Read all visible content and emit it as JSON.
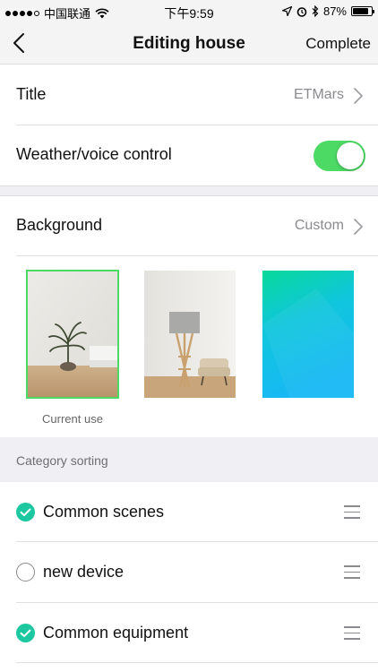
{
  "status_bar": {
    "carrier": "中国联通",
    "time": "下午9:59",
    "battery": "87%",
    "battery_level": 0.87,
    "icons": [
      "signal-dots-icon",
      "wifi-icon",
      "location-icon",
      "alarm-icon",
      "bluetooth-icon",
      "battery-icon"
    ]
  },
  "nav": {
    "title": "Editing house",
    "action": "Complete",
    "back_icon": "chevron-left-icon"
  },
  "settings": {
    "title_label": "Title",
    "title_value": "ETMars",
    "weather_label": "Weather/voice control",
    "weather_enabled": true,
    "background_label": "Background",
    "background_value": "Custom"
  },
  "backgrounds": {
    "caption": "Current use",
    "selected_index": 0
  },
  "categories": {
    "header": "Category sorting",
    "items": [
      {
        "label": "Common scenes",
        "checked": true
      },
      {
        "label": "new device",
        "checked": false
      },
      {
        "label": "Common equipment",
        "checked": true
      }
    ]
  },
  "colors": {
    "toggle_on": "#4cd964",
    "check_on": "#1dc8a0",
    "selected_outline": "#4cd964"
  }
}
